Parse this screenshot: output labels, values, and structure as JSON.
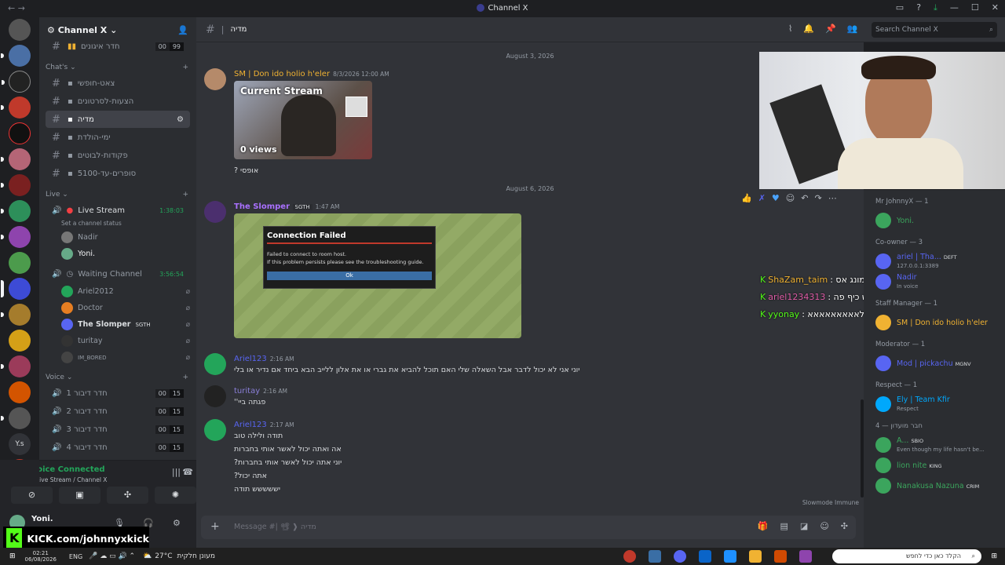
{
  "window": {
    "title": "Channel X"
  },
  "sidebar": {
    "guild_name": "Channel X",
    "top_channel": {
      "name": "חדר איגונים",
      "count_a": "00",
      "count_b": "99"
    },
    "chats_category": "Chat's",
    "chat_channels": [
      {
        "name": "צאט-חופשי",
        "selected": false
      },
      {
        "name": "הצעות-לסרטונים",
        "selected": false
      },
      {
        "name": "מדיה",
        "selected": true
      },
      {
        "name": "ימי-הולדת",
        "selected": false
      },
      {
        "name": "פקודות-לבוטים",
        "selected": false
      },
      {
        "name": "סופרים-עד-5100",
        "selected": false
      }
    ],
    "live_category": "Live",
    "live_stream": {
      "name": "Live Stream",
      "timer": "1:38:03",
      "status": "Set a channel status",
      "users": [
        "Nadir",
        "Yoni."
      ]
    },
    "waiting": {
      "name": "Waiting Channel",
      "timer": "3:56:54",
      "users": [
        "Ariel2012",
        "Doctor",
        "The Slomper",
        "turitay",
        "IM_BORED"
      ],
      "slomper_tag": "SGTH"
    },
    "voice_category": "Voice",
    "voice_channels": [
      {
        "name": "חדר דיבור 1",
        "count_a": "00",
        "count_b": "15"
      },
      {
        "name": "חדר דיבור 2",
        "count_a": "00",
        "count_b": "15"
      },
      {
        "name": "חדר דיבור 3",
        "count_a": "00",
        "count_b": "15"
      },
      {
        "name": "חדר דיבור 4",
        "count_a": "00",
        "count_b": "15"
      }
    ],
    "voice_connected": {
      "status": "Voice Connected",
      "location": "Live Stream / Channel X"
    },
    "user": {
      "name": "Yoni."
    }
  },
  "header": {
    "channel": "מדיה",
    "search_placeholder": "Search Channel X"
  },
  "messages": {
    "date1": "August 3, 2026",
    "m1": {
      "author": "SM | Don ido holio h'eler",
      "time": "8/3/2026 12:00 AM",
      "embed_title": "Current Stream",
      "embed_views": "0 views",
      "text": "אופסי ?"
    },
    "date2": "August 6, 2026",
    "m2": {
      "author": "The Slomper",
      "tag": "SGTH",
      "time": "1:47 AM",
      "dialog_title": "Connection Failed",
      "dialog_line1": "Failed to connect to room host.",
      "dialog_line2": "If this problem persists please see the troubleshooting guide.",
      "dialog_ok": "Ok"
    },
    "m3": {
      "author": "Ariel123",
      "time": "2:16 AM",
      "text": "יוני אני לא יכול לדבר אבל השאלה שלי האם תוכל להביא את גברי או את אלון ללייב הבא ביחד אם נדיר או בלי"
    },
    "m4": {
      "author": "turitay",
      "time": "2:16 AM",
      "text": "פגתה ביי''"
    },
    "m5": {
      "author": "Ariel123",
      "time": "2:17 AM",
      "lines": [
        "תודה ולילה טוב",
        "אה ואתה יכול לאשר אותי בחברות",
        "יוני אתה יכול לאשר אותי בחברות?",
        "אתה יכול?",
        "יששששש תודה"
      ]
    },
    "composer_placeholder": "Message #| 📽 ❱ מדיה",
    "slowmode": "Slowmode Immune"
  },
  "overlay_chat": [
    {
      "user": "ShaZam_taim",
      "text": "חן לנו באמונג אס :"
    },
    {
      "user": "ariel1234313",
      "text": "יוני ממש כיף פה :"
    },
    {
      "user": "yyonay",
      "text": "לאאאאאאאאא :"
    }
  ],
  "members": {
    "groups": [
      {
        "title": "Mr JohnnyX — 1",
        "members": [
          {
            "name": "Yoni.",
            "sub": "",
            "color": "#3ba55d"
          }
        ]
      },
      {
        "title": "Co-owner — 3",
        "members": [
          {
            "name": "ariel | Tha...",
            "sub": "127.0.0.1:3389",
            "color": "#5865f2",
            "tag": "DEFT"
          },
          {
            "name": "Nadir",
            "sub": "In voice",
            "color": "#5865f2"
          }
        ]
      },
      {
        "title": "Staff Manager — 1",
        "members": [
          {
            "name": "SM | Don ido holio h'eler",
            "sub": "",
            "color": "#f0b232"
          }
        ]
      },
      {
        "title": "Moderator — 1",
        "members": [
          {
            "name": "Mod | pickachu",
            "sub": "",
            "color": "#5865f2",
            "tag": "MGNV"
          }
        ]
      },
      {
        "title": "Respect — 1",
        "members": [
          {
            "name": "Ely | Team Kfir",
            "sub": "Respect",
            "color": "#00a8fc"
          }
        ]
      },
      {
        "title": "חבר מועדון — 4",
        "members": [
          {
            "name": "A...",
            "sub": "Even though my life hasn't be...",
            "color": "#3ba55d",
            "tag": "SBIO"
          },
          {
            "name": "lion nite",
            "sub": "",
            "color": "#3ba55d",
            "tag": "KING"
          },
          {
            "name": "Nanakusa Nazuna",
            "sub": "",
            "color": "#3ba55d",
            "tag": "CRIM"
          }
        ]
      }
    ]
  },
  "kick_banner": "KICK.com/johnnyxkick",
  "taskbar": {
    "time": "02:21",
    "date": "06/08/2026",
    "lang": "ENG",
    "temp": "27°C",
    "weather": "מעונן חלקית",
    "search": "הקלד כאן כדי לחפש"
  }
}
